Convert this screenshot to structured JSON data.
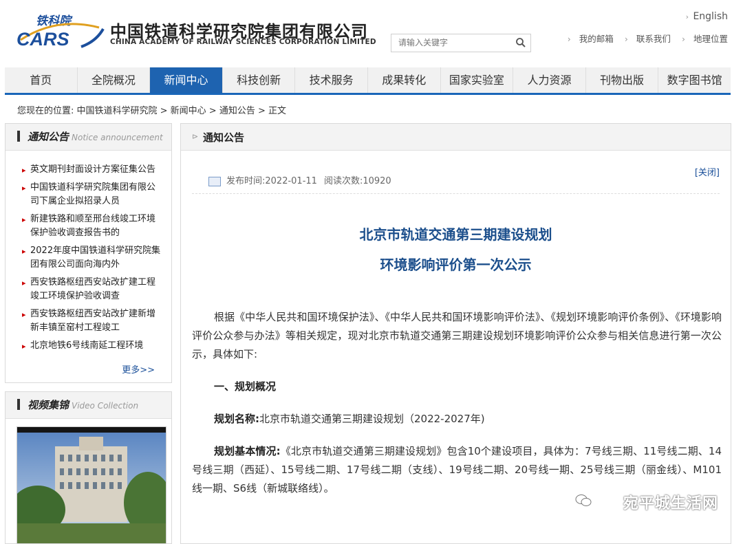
{
  "header": {
    "logo_calligraphy": "铁科院",
    "logo_mark": "CARS",
    "org_name_cn": "中国铁道科学研究院集团有限公司",
    "org_name_en": "CHINA ACADEMY OF RAILWAY SCIENCES CORPORATION LIMITED",
    "search_placeholder": "请输入关键字",
    "english_link": "English",
    "links": [
      "我的邮箱",
      "联系我们",
      "地理位置"
    ]
  },
  "nav": {
    "items": [
      "首页",
      "全院概况",
      "新闻中心",
      "科技创新",
      "技术服务",
      "成果转化",
      "国家实验室",
      "人力资源",
      "刊物出版",
      "数字图书馆"
    ],
    "active_index": 2
  },
  "breadcrumb": "您现在的位置: 中国铁道科学研究院 > 新闻中心 > 通知公告 > 正文",
  "sidebar": {
    "notice_title": "通知公告",
    "notice_subtitle": "Notice announcement",
    "notices": [
      "英文期刊封面设计方案征集公告",
      "中国铁道科学研究院集团有限公司下属企业拟招录人员",
      "新建铁路和顺至邢台线竣工环境保护验收调查报告书的",
      "2022年度中国铁道科学研究院集团有限公司面向海内外",
      "西安铁路枢纽西安站改扩建工程竣工环境保护验收调查",
      "西安铁路枢纽西安站改扩建新增新丰镇至窑村工程竣工",
      "北京地铁6号线南延工程环境"
    ],
    "more_label": "更多>>",
    "video_title": "视频集锦",
    "video_subtitle": "Video Collection"
  },
  "article": {
    "section_title": "通知公告",
    "publish_time": "发布时间:2022-01-11",
    "read_count": "阅读次数:10920",
    "close_label": "[关闭]",
    "title_line1": "北京市轨道交通第三期建设规划",
    "title_line2": "环境影响评价第一次公示",
    "intro": "根据《中华人民共和国环境保护法》、《中华人民共和国环境影响评价法》、《规划环境影响评价条例》、《环境影响评价公众参与办法》等相关规定，现对北京市轨道交通第三期建设规划环境影响评价公众参与相关信息进行第一次公示，具体如下:",
    "section1": "一、规划概况",
    "plan_name_label": "规划名称:",
    "plan_name_value": "北京市轨道交通第三期建设规划（2022-2027年)",
    "plan_basic_label": "规划基本情况:",
    "plan_basic_value": "《北京市轨道交通第三期建设规划》包含10个建设项目，具体为：7号线三期、11号线二期、14号线三期（西延）、15号线二期、17号线二期（支线）、19号线二期、20号线一期、25号线三期（丽金线）、M101线一期、S6线（新城联络线）。"
  },
  "watermark": "宛平城生活网"
}
